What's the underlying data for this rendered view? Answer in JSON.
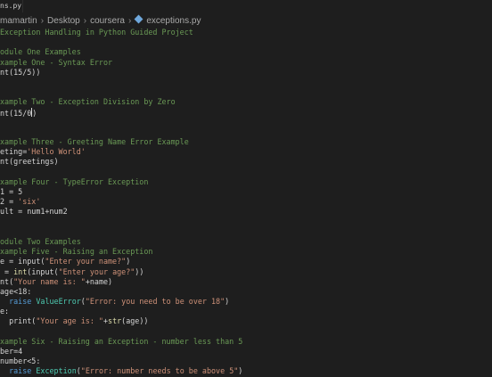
{
  "tab": {
    "label": "ns.py"
  },
  "breadcrumb": [
    "mamartin",
    "Desktop",
    "coursera",
    "exceptions.py"
  ],
  "code_lines": [
    [
      [
        "c",
        "Exception Handling in Python Guided Project"
      ]
    ],
    [],
    [
      [
        "c",
        "odule One Examples"
      ]
    ],
    [
      [
        "c",
        "xample One - Syntax Error"
      ]
    ],
    [
      [
        "t",
        "nt(15/5))"
      ]
    ],
    [],
    [],
    [
      [
        "c",
        "xample Two - Exception Division by Zero"
      ]
    ],
    [
      [
        "t",
        "nt(15/0"
      ],
      [
        "cursor",
        ""
      ],
      [
        "t",
        ")"
      ]
    ],
    [],
    [],
    [
      [
        "c",
        "xample Three - Greeting Name Error Example"
      ]
    ],
    [
      [
        "t",
        "eting="
      ],
      [
        "s",
        "'Hello World'"
      ]
    ],
    [
      [
        "t",
        "nt(greetings)"
      ]
    ],
    [],
    [
      [
        "c",
        "xample Four - TypeError Exception"
      ]
    ],
    [
      [
        "t",
        "1 = 5"
      ]
    ],
    [
      [
        "t",
        "2 = "
      ],
      [
        "s",
        "'six'"
      ]
    ],
    [
      [
        "t",
        "ult = num1+num2"
      ]
    ],
    [],
    [],
    [
      [
        "c",
        "odule Two Examples"
      ]
    ],
    [
      [
        "c",
        "xample Five - Raising an Exception"
      ]
    ],
    [
      [
        "t",
        "e = input("
      ],
      [
        "s",
        "\"Enter your name?\""
      ],
      [
        "t",
        ")"
      ]
    ],
    [
      [
        "t",
        " = "
      ],
      [
        "fn",
        "int"
      ],
      [
        "t",
        "(input("
      ],
      [
        "s",
        "\"Enter your age?\""
      ],
      [
        "t",
        "))"
      ]
    ],
    [
      [
        "t",
        "nt("
      ],
      [
        "s",
        "\"Your name is: \""
      ],
      [
        "t",
        "+name)"
      ]
    ],
    [
      [
        "t",
        "age<18:"
      ]
    ],
    [
      [
        "t",
        "  "
      ],
      [
        "k",
        "raise"
      ],
      [
        "t",
        " "
      ],
      [
        "cls",
        "ValueError"
      ],
      [
        "t",
        "("
      ],
      [
        "s",
        "\"Error: you need to be over 18\""
      ],
      [
        "t",
        ")"
      ]
    ],
    [
      [
        "t",
        "e:"
      ]
    ],
    [
      [
        "t",
        "  print("
      ],
      [
        "s",
        "\"Your age is: \""
      ],
      [
        "t",
        "+"
      ],
      [
        "fn",
        "str"
      ],
      [
        "t",
        "(age))"
      ]
    ],
    [],
    [
      [
        "c",
        "xample Six - Raising an Exception - number less than 5"
      ]
    ],
    [
      [
        "t",
        "ber=4"
      ]
    ],
    [
      [
        "t",
        "number<5:"
      ]
    ],
    [
      [
        "t",
        "  "
      ],
      [
        "k",
        "raise"
      ],
      [
        "t",
        " "
      ],
      [
        "cls",
        "Exception"
      ],
      [
        "t",
        "("
      ],
      [
        "s",
        "\"Error: number needs to be above 5\""
      ],
      [
        "t",
        ")"
      ]
    ]
  ]
}
